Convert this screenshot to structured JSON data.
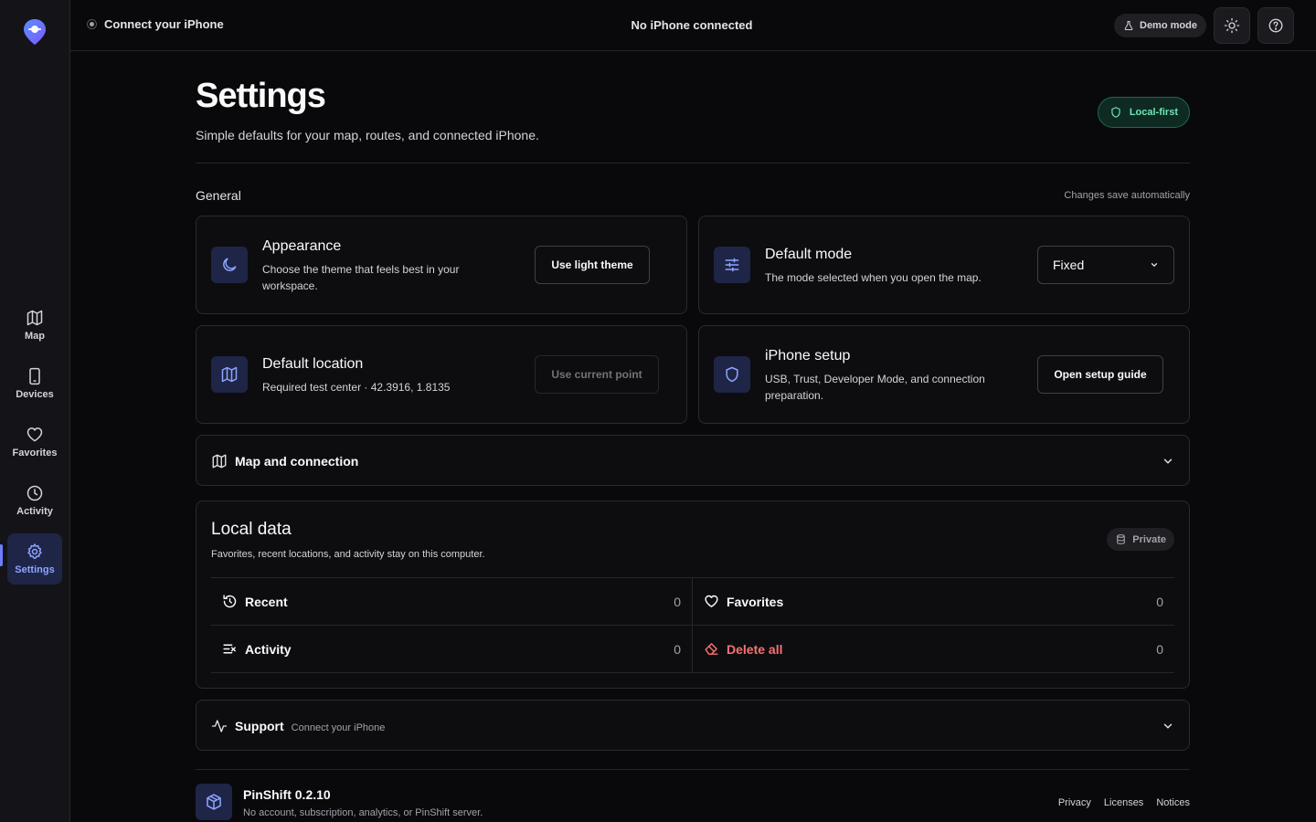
{
  "topbar": {
    "connect_label": "Connect your iPhone",
    "status": "No iPhone connected",
    "demo_label": "Demo mode"
  },
  "sidebar": {
    "items": [
      {
        "label": "Map",
        "icon": "map-icon"
      },
      {
        "label": "Devices",
        "icon": "phone-icon"
      },
      {
        "label": "Favorites",
        "icon": "heart-icon"
      },
      {
        "label": "Activity",
        "icon": "clock-icon"
      },
      {
        "label": "Settings",
        "icon": "gear-icon",
        "active": true
      }
    ]
  },
  "page": {
    "title": "Settings",
    "subtitle": "Simple defaults for your map, routes, and connected iPhone.",
    "badge": "Local-first"
  },
  "general": {
    "title": "General",
    "note": "Changes save automatically",
    "appearance": {
      "title": "Appearance",
      "desc": "Choose the theme that feels best in your workspace.",
      "button": "Use light theme"
    },
    "default_mode": {
      "title": "Default mode",
      "desc": "The mode selected when you open the map.",
      "value": "Fixed"
    },
    "default_location": {
      "title": "Default location",
      "desc": "Required test center · 42.3916, 1.8135",
      "button": "Use current point"
    },
    "iphone_setup": {
      "title": "iPhone setup",
      "desc": "USB, Trust, Developer Mode, and connection preparation.",
      "button": "Open setup guide"
    }
  },
  "map_connection": {
    "title": "Map and connection"
  },
  "local_data": {
    "title": "Local data",
    "desc": "Favorites, recent locations, and activity stay on this computer.",
    "badge": "Private",
    "recent": {
      "label": "Recent",
      "count": "0"
    },
    "favorites": {
      "label": "Favorites",
      "count": "0"
    },
    "activity": {
      "label": "Activity",
      "count": "0"
    },
    "delete_all": {
      "label": "Delete all",
      "count": "0"
    }
  },
  "support": {
    "title": "Support",
    "subtitle": "Connect your iPhone"
  },
  "footer": {
    "name": "PinShift 0.2.10",
    "desc": "No account, subscription, analytics, or PinShift server.",
    "links": [
      "Privacy",
      "Licenses",
      "Notices"
    ]
  },
  "colors": {
    "accent": "#6d7dff",
    "danger": "#f87171",
    "success": "#6ee7b7",
    "background": "#09090b"
  }
}
